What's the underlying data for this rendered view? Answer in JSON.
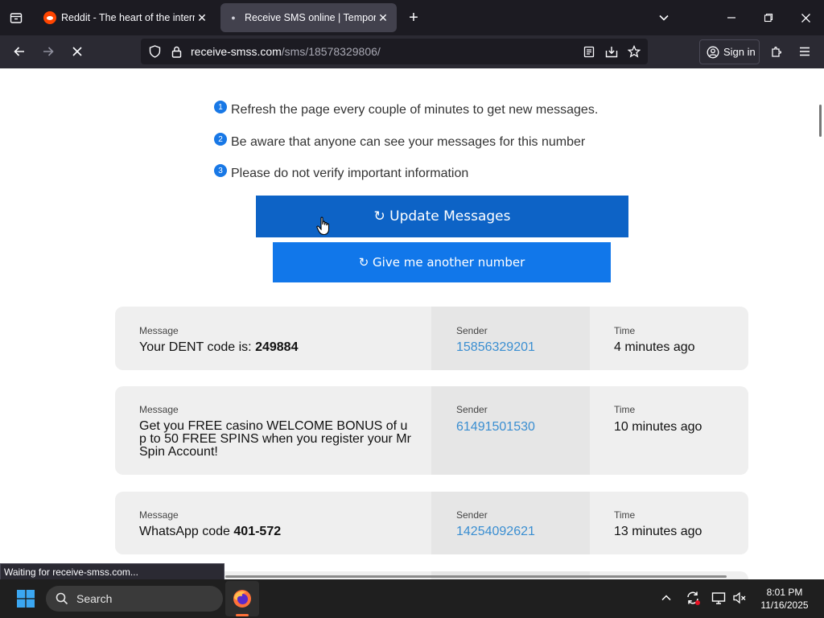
{
  "browser": {
    "tabs": [
      {
        "title": "Reddit - The heart of the internet"
      },
      {
        "title": "Receive SMS online | Temporary"
      }
    ],
    "url_domain": "receive-smss.com",
    "url_path": "/sms/18578329806/",
    "sign_in_label": "Sign in",
    "status_text": "Waiting for receive-smss.com..."
  },
  "page": {
    "tips": [
      {
        "num": "1",
        "text": "Refresh the page every couple of minutes to get new messages."
      },
      {
        "num": "2",
        "text": "Be aware that anyone can see your messages for this number"
      },
      {
        "num": "3",
        "text": "Please do not verify important information"
      }
    ],
    "update_label": "↻ Update Messages",
    "another_label": "↻ Give me another number",
    "labels": {
      "message": "Message",
      "sender": "Sender",
      "time": "Time"
    },
    "messages": [
      {
        "text": "Your DENT code is: ",
        "code": "249884",
        "sender": "15856329201",
        "time": "4 minutes ago"
      },
      {
        "text": "Get you FREE casino WELCOME BONUS of up to 50 FREE SPINS when you register your Mr Spin Account!",
        "code": "",
        "sender": "61491501530",
        "time": "10 minutes ago"
      },
      {
        "text": "WhatsApp code ",
        "code": "401-572",
        "sender": "14254092621",
        "time": "13 minutes ago"
      }
    ]
  },
  "taskbar": {
    "search_label": "Search",
    "time": "8:01 PM",
    "date": "11/16/2025"
  },
  "colors": {
    "accent": "#0d63c6",
    "accent_light": "#1177ea",
    "sender_link": "#3a8ed1"
  }
}
